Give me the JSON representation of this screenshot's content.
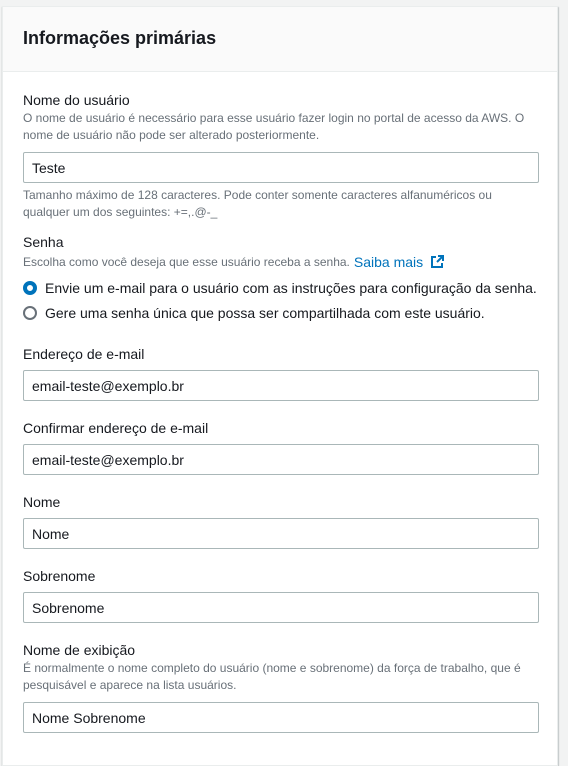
{
  "section": {
    "title": "Informações primárias"
  },
  "username": {
    "label": "Nome do usuário",
    "description": "O nome de usuário é necessário para esse usuário fazer login no portal de acesso da AWS. O nome de usuário não pode ser alterado posteriormente.",
    "value": "Teste",
    "constraint": "Tamanho máximo de 128 caracteres. Pode conter somente caracteres alfanuméricos ou qualquer um dos seguintes: +=,.@-_"
  },
  "password": {
    "label": "Senha",
    "description": "Escolha como você deseja que esse usuário receba a senha.",
    "learn_more": "Saiba mais",
    "options": [
      {
        "label": "Envie um e-mail para o usuário com as instruções para configuração da senha.",
        "selected": true
      },
      {
        "label": "Gere uma senha única que possa ser compartilhada com este usuário.",
        "selected": false
      }
    ]
  },
  "email": {
    "label": "Endereço de e-mail",
    "value": "email-teste@exemplo.br"
  },
  "confirm_email": {
    "label": "Confirmar endereço de e-mail",
    "value": "email-teste@exemplo.br"
  },
  "first_name": {
    "label": "Nome",
    "placeholder": "Nome"
  },
  "last_name": {
    "label": "Sobrenome",
    "placeholder": "Sobrenome"
  },
  "display_name": {
    "label": "Nome de exibição",
    "description": "É normalmente o nome completo do usuário (nome e sobrenome) da força de trabalho, que é pesquisável e aparece na lista usuários.",
    "placeholder": "Nome Sobrenome"
  },
  "colors": {
    "accent": "#0073bb",
    "border": "#aab7b8",
    "muted_text": "#687078"
  },
  "icons": {
    "learn_more": "external-link-icon"
  }
}
